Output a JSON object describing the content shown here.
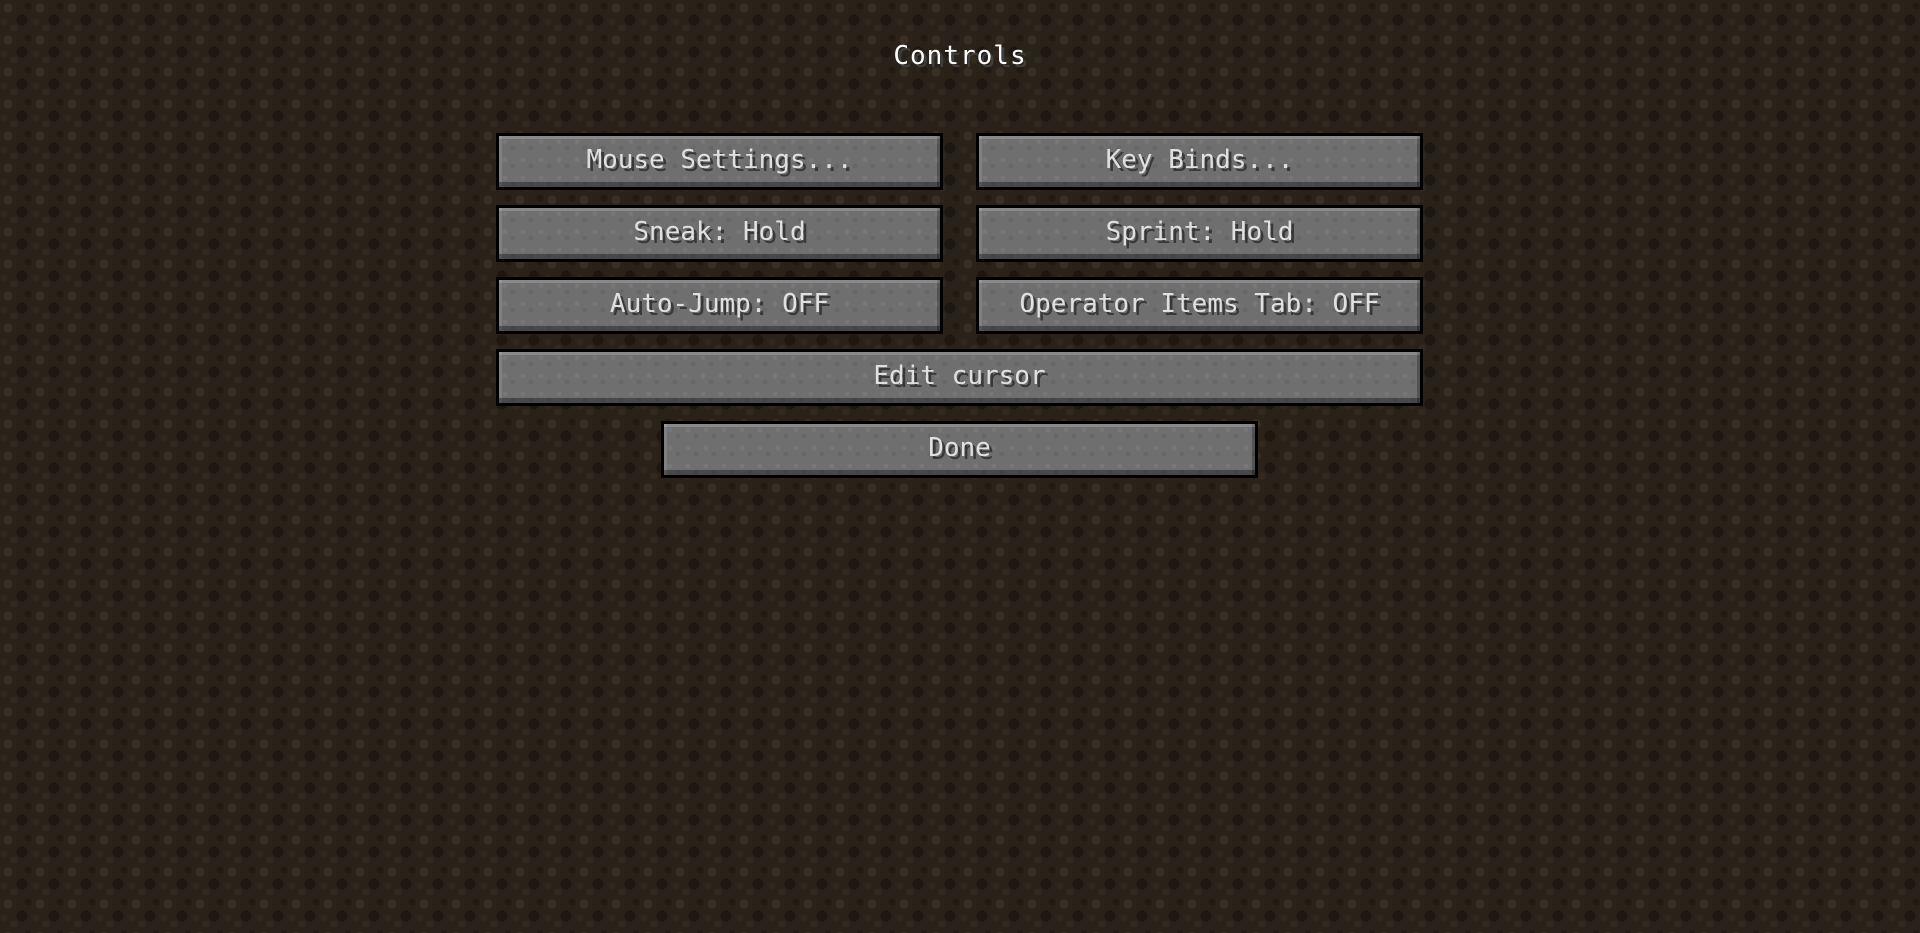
{
  "screen": {
    "title": "Controls"
  },
  "buttons": {
    "mouse_settings": "Mouse Settings...",
    "key_binds": "Key Binds...",
    "sneak": "Sneak: Hold",
    "sprint": "Sprint: Hold",
    "auto_jump": "Auto-Jump: OFF",
    "operator_items_tab": "Operator Items Tab: OFF",
    "edit_cursor": "Edit cursor",
    "done": "Done"
  },
  "colors": {
    "background": "#2a2219",
    "button_face": "#6f6f6f",
    "button_border": "#000000",
    "text": "#e0e0e0",
    "title_text": "#ffffff"
  }
}
